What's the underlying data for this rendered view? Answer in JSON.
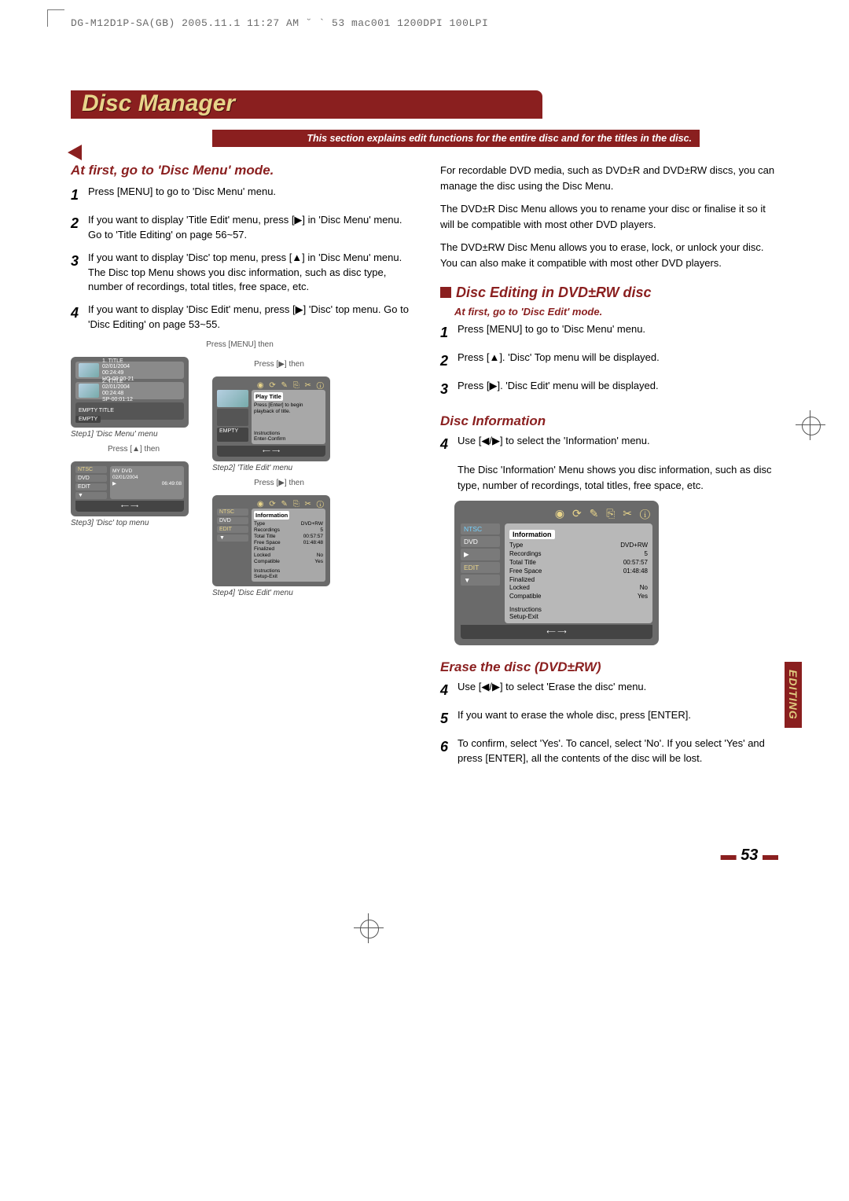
{
  "print_header": "DG-M12D1P-SA(GB)  2005.11.1 11:27 AM  ˘  `  53   mac001  1200DPI 100LPI",
  "title": "Disc Manager",
  "subtitle": "This section explains edit functions for the entire disc and for the titles in the disc.",
  "left": {
    "heading": "At first, go to 'Disc Menu' mode.",
    "steps": [
      "Press [MENU] to go to 'Disc Menu' menu.",
      "If you want to display 'Title Edit' menu, press [▶] in 'Disc Menu' menu. Go to 'Title Editing' on page 56~57.",
      "If you want to display 'Disc' top menu, press [▲] in 'Disc Menu' menu. The Disc top Menu shows you disc information, such as disc type, number of recordings, total titles, free space, etc.",
      "If you want to display 'Disc Edit' menu, press [▶] 'Disc' top menu. Go to 'Disc Editing' on page 53~55."
    ],
    "cap_menu_then": "Press [MENU] then",
    "cap_play_then": "Press [▶] then",
    "cap_up_then": "Press [▲] then",
    "osd1": {
      "t1_title": "1. TITLE",
      "t1_date": "02/01/2004",
      "t1_dur": "00:24:49",
      "t1_mode": "HQ-09:00-21",
      "t2_title": "2. TITLE",
      "t2_date": "02/01/2004",
      "t2_dur": "00:24:48",
      "t2_mode": "SP-00:01:12",
      "empty": "EMPTY TITLE",
      "empty_badge": "EMPTY",
      "caption": "Step1] 'Disc Menu' menu"
    },
    "osd2": {
      "play_title": "Play Title",
      "play_hint": "Press [Enter] to begin playback of title.",
      "empty_badge": "EMPTY",
      "instr": "Instructions",
      "instr2": "Enter-Confirm",
      "caption": "Step2] 'Title Edit' menu"
    },
    "osd3": {
      "ntsc": "NTSC",
      "dvd": "DVD",
      "edit": "EDIT",
      "my_dvd": "MY DVD",
      "date": "02/01/2004",
      "time": "06:49:08",
      "caption": "Step3] 'Disc' top menu"
    },
    "osd4": {
      "ntsc": "NTSC",
      "dvd": "DVD",
      "edit": "EDIT",
      "heading": "Information",
      "rows": {
        "Type": "DVD+RW",
        "Recordings": "5",
        "Total Title": "00:57:57",
        "Free Space": "01:48:48",
        "Finalized": "",
        "Locked": "No",
        "Compatible": "Yes"
      },
      "instr": "Instructions",
      "instr2": "Setup-Exit",
      "caption": "Step4] 'Disc Edit' menu"
    }
  },
  "right": {
    "intro": [
      "For recordable DVD media, such as DVD±R and DVD±RW discs, you can manage the disc using the Disc Menu.",
      "The DVD±R Disc Menu allows you to rename your disc or finalise it so it will be compatible with most other DVD players.",
      "The DVD±RW Disc Menu allows you to erase, lock, or unlock your disc. You can also make it compatible with most other DVD players."
    ],
    "editing_heading": "Disc Editing in DVD±RW disc",
    "edit_mode_heading": "At first, go to 'Disc Edit' mode.",
    "edit_steps": [
      "Press [MENU] to go to 'Disc Menu' menu.",
      "Press [▲]. 'Disc' Top menu will be displayed.",
      "Press [▶]. 'Disc Edit' menu will be displayed."
    ],
    "info_heading": "Disc Information",
    "info_step4": "Use [◀/▶] to select the 'Information' menu.",
    "info_body": "The Disc 'Information' Menu shows you disc information, such as disc type, number of recordings, total titles, free space, etc.",
    "info_panel": {
      "ntsc": "NTSC",
      "dvd": "DVD",
      "edit": "EDIT",
      "heading": "Information",
      "rows": {
        "Type": "DVD+RW",
        "Recordings": "5",
        "Total Title": "00:57:57",
        "Free Space": "01:48:48",
        "Finalized": "",
        "Locked": "No",
        "Compatible": "Yes"
      },
      "instr": "Instructions",
      "instr2": "Setup-Exit"
    },
    "erase_heading": "Erase the disc (DVD±RW)",
    "erase_steps": {
      "s4": "Use [◀/▶] to select 'Erase the disc' menu.",
      "s5": "If you want to erase the whole disc, press [ENTER].",
      "s6": "To confirm, select 'Yes'. To cancel, select 'No'. If you select 'Yes' and press [ENTER], all the contents of the disc will be lost."
    }
  },
  "side_tab": "EDITING",
  "page_number": "53"
}
